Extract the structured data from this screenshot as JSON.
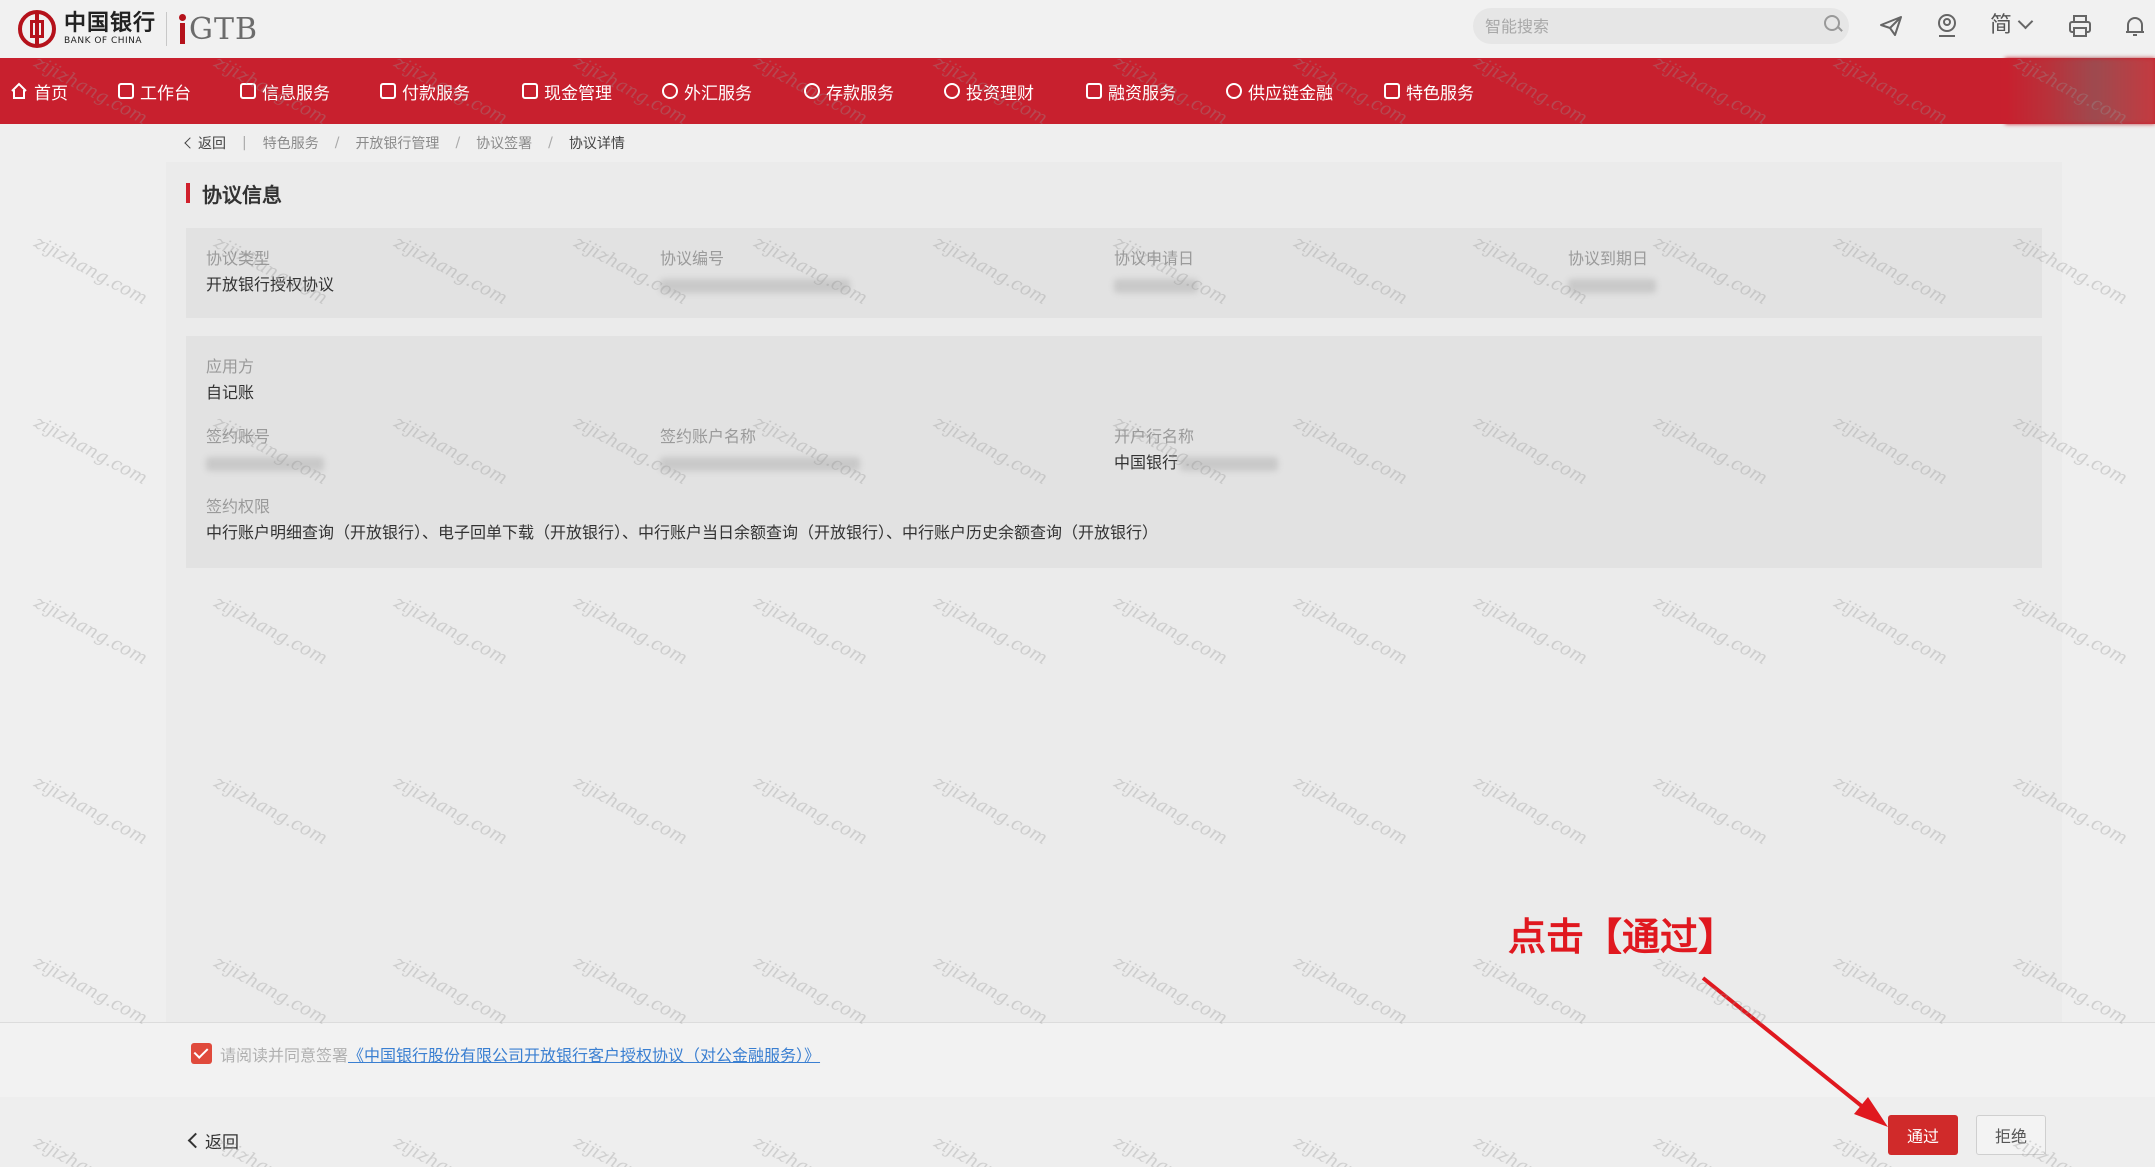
{
  "header": {
    "logo_cn": "中国银行",
    "logo_en": "BANK OF CHINA",
    "logo_gtb": "GTB",
    "search_placeholder": "智能搜索",
    "lang": "简"
  },
  "nav": {
    "items": [
      {
        "label": "首页",
        "icon": "home-icon"
      },
      {
        "label": "工作台",
        "icon": "workbench-icon"
      },
      {
        "label": "信息服务",
        "icon": "info-service-icon"
      },
      {
        "label": "付款服务",
        "icon": "payment-icon"
      },
      {
        "label": "现金管理",
        "icon": "cash-icon"
      },
      {
        "label": "外汇服务",
        "icon": "forex-icon"
      },
      {
        "label": "存款服务",
        "icon": "deposit-icon"
      },
      {
        "label": "投资理财",
        "icon": "invest-icon"
      },
      {
        "label": "融资服务",
        "icon": "finance-icon"
      },
      {
        "label": "供应链金融",
        "icon": "supply-chain-icon"
      },
      {
        "label": "特色服务",
        "icon": "special-service-icon"
      }
    ]
  },
  "breadcrumb": {
    "back": "返回",
    "items": [
      "特色服务",
      "开放银行管理",
      "协议签署",
      "协议详情"
    ]
  },
  "section": {
    "title": "协议信息"
  },
  "agreement": {
    "type_label": "协议类型",
    "type_value": "开放银行授权协议",
    "number_label": "协议编号",
    "apply_date_label": "协议申请日",
    "expire_date_label": "协议到期日"
  },
  "account": {
    "app_label": "应用方",
    "app_value": "自记账",
    "acct_no_label": "签约账号",
    "acct_name_label": "签约账户名称",
    "bank_label": "开户行名称",
    "bank_value": "中国银行",
    "perm_label": "签约权限",
    "perm_value": "中行账户明细查询（开放银行）、电子回单下载（开放银行）、中行账户当日余额查询（开放银行）、中行账户历史余额查询（开放银行）"
  },
  "agree": {
    "prefix": "请阅读并同意签署",
    "link": "《中国银行股份有限公司开放银行客户授权协议（对公金融服务）》"
  },
  "footer": {
    "back": "返回",
    "pass": "通过",
    "reject": "拒绝"
  },
  "annotation": {
    "text": "点击【通过】",
    "color": "#e0181f"
  },
  "watermark": "zijizhang.com",
  "colors": {
    "brand_red": "#c8202e",
    "link_blue": "#3a7fd1"
  }
}
